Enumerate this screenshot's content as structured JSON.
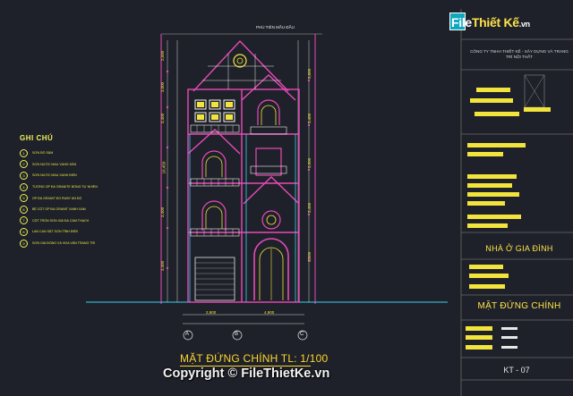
{
  "watermark": {
    "logo_part1": "File",
    "logo_part2": "Thiết Kế",
    "logo_suffix": ".vn"
  },
  "notes": {
    "title": "GHI CHÚ",
    "items": [
      {
        "num": "1",
        "text": "SƠN ĐỎ SẪM"
      },
      {
        "num": "2",
        "text": "SƠN NƯỚC MÀU VÀNG KEM"
      },
      {
        "num": "3",
        "text": "SƠN NƯỚC MÀU XANH BIỂN"
      },
      {
        "num": "4",
        "text": "TƯỜNG ỐP ĐÁ GRANITE BÓNG TỰ NHIÊN"
      },
      {
        "num": "5",
        "text": "ỐP ĐÁ GRANIT ĐỎ RUBY ẤN ĐỘ"
      },
      {
        "num": "6",
        "text": "BỆ CỘT ỐP ĐÁ GRANIT XANH XÁM"
      },
      {
        "num": "7",
        "text": "CỘT TRÒN SƠN GIẢ ĐÁ CẨM THẠCH"
      },
      {
        "num": "8",
        "text": "LAN CAN SẮT SƠN TĨNH ĐIỆN"
      },
      {
        "num": "9",
        "text": "SƠN GIẢ ĐỒNG VÀ HOA VĂN TRANG TRÍ"
      }
    ]
  },
  "elevation": {
    "top_note": "PHÙ TIÊN MẦU ĐẦU",
    "caption": "MẶT ĐỨNG CHÍNH TL: 1/100",
    "dims_bottom": [
      "2,900",
      "4,900"
    ],
    "axis_labels": [
      "A",
      "B",
      "C"
    ],
    "dims_left": [
      "2,500",
      "3,000",
      "3,400",
      "3,750",
      "3,400",
      "3,400",
      "3,400",
      "3,300"
    ],
    "dims_right": [
      "3,000",
      "3,400",
      "3,500",
      "3,400",
      "3,500"
    ],
    "total_height": "16,450"
  },
  "title_block": {
    "company": "CÔNG TY TNHH THIẾT KẾ - XÂY DỰNG VÀ TRANG TRÍ NỘI THẤT",
    "project": "NHÀ Ở GIA ĐÌNH",
    "drawing": "MẶT ĐỨNG CHÍNH",
    "sheet": "KT - 07"
  },
  "copyright": "Copyright © FileThietKe.vn"
}
